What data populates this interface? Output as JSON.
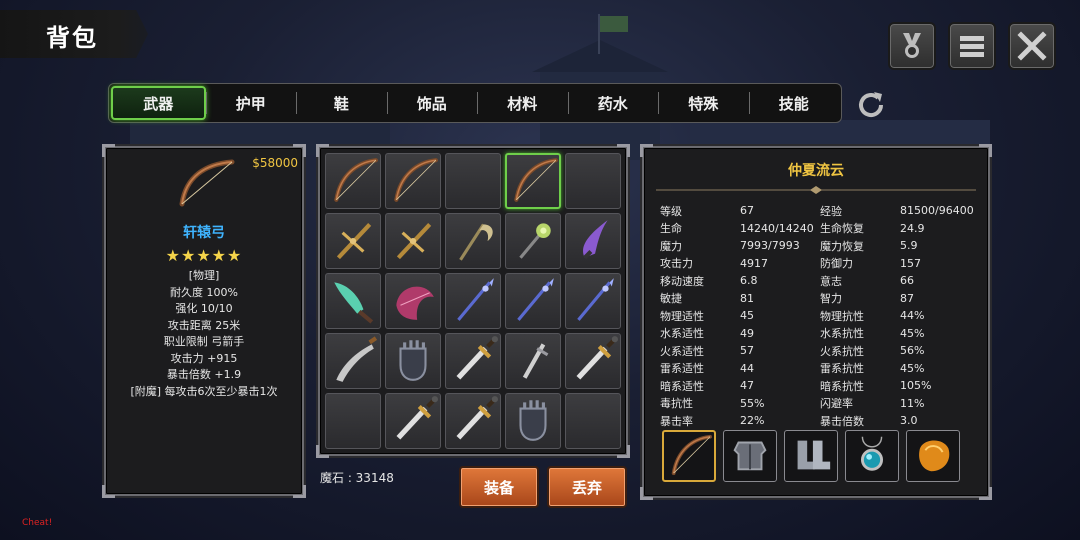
{
  "header": {
    "title": "背包"
  },
  "top_buttons": [
    {
      "icon": "medal-icon"
    },
    {
      "icon": "menu-icon"
    },
    {
      "icon": "close-icon"
    }
  ],
  "tabs": [
    "武器",
    "护甲",
    "鞋",
    "饰品",
    "材料",
    "药水",
    "特殊",
    "技能"
  ],
  "active_tab": "武器",
  "item": {
    "price": "$58000",
    "name": "轩辕弓",
    "stars": "★★★★★",
    "stats": [
      "[物理]",
      "耐久度 100%",
      "强化 10/10",
      "攻击距离  25米",
      "职业限制  弓箭手",
      "攻击力  +915",
      "暴击倍数  +1.9",
      "[附魔] 每攻击6次至少暴击1次"
    ]
  },
  "inventory": {
    "slots": [
      "bow-icon",
      "bow-icon",
      "",
      "bow-icon",
      "",
      "crossbow-icon",
      "crossbow-icon",
      "scythe-icon",
      "mace-icon",
      "blade-icon",
      "jade-dagger-icon",
      "fan-icon",
      "spear-icon",
      "spear-icon",
      "spear-icon",
      "scimitar-icon",
      "gauntlet-icon",
      "sword-icon",
      "dagger-icon",
      "sword-icon",
      "",
      "sword-icon",
      "sword-icon",
      "gauntlet-icon",
      ""
    ],
    "selected_index": 3
  },
  "mana_stone": "魔石 : 33148",
  "buttons": {
    "equip": "装备",
    "discard": "丢弃"
  },
  "character": {
    "name": "仲夏流云",
    "stats": [
      [
        "等级",
        "67",
        "经验",
        "81500/96400"
      ],
      [
        "生命",
        "14240/14240",
        "生命恢复",
        "24.9"
      ],
      [
        "魔力",
        "7993/7993",
        "魔力恢复",
        "5.9"
      ],
      [
        "攻击力",
        "4917",
        "防御力",
        "157"
      ],
      [
        "移动速度",
        "6.8",
        "意志",
        "66"
      ],
      [
        "敏捷",
        "81",
        "智力",
        "87"
      ],
      [
        "物理适性",
        "45",
        "物理抗性",
        "44%"
      ],
      [
        "水系适性",
        "49",
        "水系抗性",
        "45%"
      ],
      [
        "火系适性",
        "57",
        "火系抗性",
        "56%"
      ],
      [
        "雷系适性",
        "44",
        "雷系抗性",
        "45%"
      ],
      [
        "暗系适性",
        "47",
        "暗系抗性",
        "105%"
      ],
      [
        "毒抗性",
        "55%",
        "闪避率",
        "11%"
      ],
      [
        "暴击率",
        "22%",
        "暴击倍数",
        "3.0"
      ]
    ],
    "equipment": [
      "bow-icon",
      "armor-icon",
      "boots-icon",
      "amulet-icon",
      "gem-icon"
    ]
  },
  "debug_label": "Cheat!",
  "colors": {
    "accent_green": "#6fcf4a",
    "gold": "#f0c542",
    "item_name_blue": "#3fb4ff",
    "button_orange": "#d2692e"
  }
}
